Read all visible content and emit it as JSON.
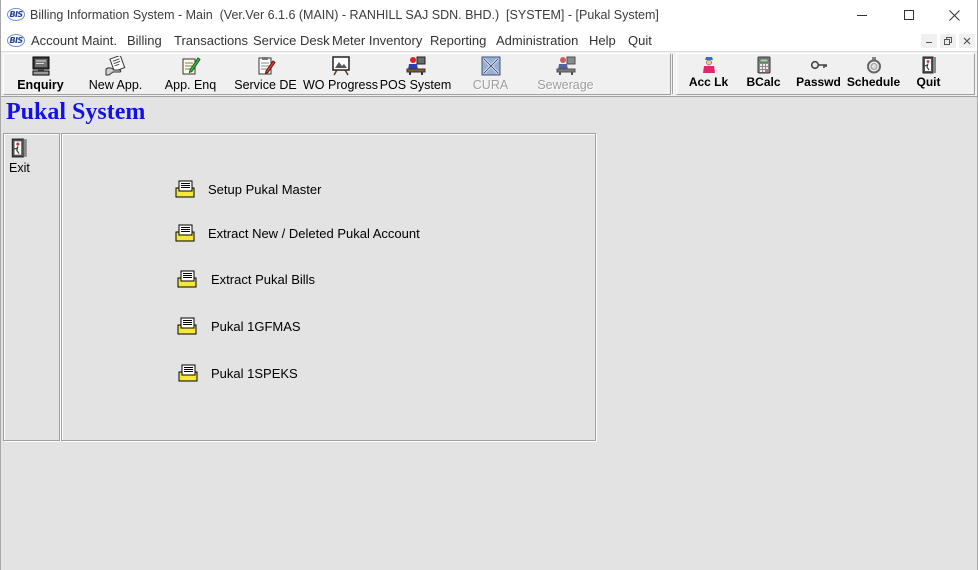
{
  "window": {
    "logo_text": "BIS",
    "title": "Billing Information System - Main  (Ver.Ver 6.1.6 (MAIN) - RANHILL SAJ SDN. BHD.)  [SYSTEM] - [Pukal System]",
    "controls": [
      "minimize-icon",
      "maximize-icon",
      "close-icon"
    ]
  },
  "menu": {
    "logo_text": "BIS",
    "items": [
      "Account Maint.",
      "Billing",
      "Transactions",
      "Service Desk",
      "Meter Inventory",
      "Reporting",
      "Administration",
      "Help",
      "Quit"
    ],
    "mdi_controls": [
      "mdi-minimize-icon",
      "mdi-restore-icon",
      "mdi-close-icon"
    ]
  },
  "toolbar": {
    "main_buttons": [
      {
        "label": "Enquiry",
        "icon": "computer-icon",
        "enabled": true
      },
      {
        "label": "New App.",
        "icon": "new-application-icon",
        "enabled": true
      },
      {
        "label": "App. Enq",
        "icon": "notepad-pencil-icon",
        "enabled": true
      },
      {
        "label": "Service DE",
        "icon": "clipboard-pencil-icon",
        "enabled": true
      },
      {
        "label": "WO Progress",
        "icon": "easel-board-icon",
        "enabled": true
      },
      {
        "label": "POS System",
        "icon": "cashier-icon",
        "enabled": true
      },
      {
        "label": "CURA",
        "icon": "cura-icon",
        "enabled": false
      },
      {
        "label": "Sewerage",
        "icon": "sewerage-icon",
        "enabled": false
      }
    ],
    "utility_buttons": [
      {
        "label": "Acc Lk",
        "icon": "account-lookup-icon",
        "enabled": true
      },
      {
        "label": "BCalc",
        "icon": "calculator-icon",
        "enabled": true
      },
      {
        "label": "Passwd",
        "icon": "key-icon",
        "enabled": true
      },
      {
        "label": "Schedule",
        "icon": "schedule-icon",
        "enabled": true
      },
      {
        "label": "Quit",
        "icon": "exit-door-icon",
        "enabled": true
      }
    ]
  },
  "form": {
    "title": "Pukal System",
    "sidebar": {
      "exit_label": "Exit",
      "exit_icon": "exit-door-icon"
    },
    "options": [
      {
        "label": "Setup Pukal Master",
        "icon": "document-tray-icon"
      },
      {
        "label": "Extract New / Deleted Pukal Account",
        "icon": "document-tray-icon"
      },
      {
        "label": "Extract Pukal Bills",
        "icon": "document-tray-icon"
      },
      {
        "label": "Pukal 1GFMAS",
        "icon": "document-tray-icon"
      },
      {
        "label": "Pukal 1SPEKS",
        "icon": "document-tray-icon"
      }
    ]
  },
  "colors": {
    "form_title": "#1212e6",
    "toolbar_bg": "#f0f0f0",
    "client_bg": "#e3e3e3",
    "disabled_text": "#9d9d9d"
  }
}
